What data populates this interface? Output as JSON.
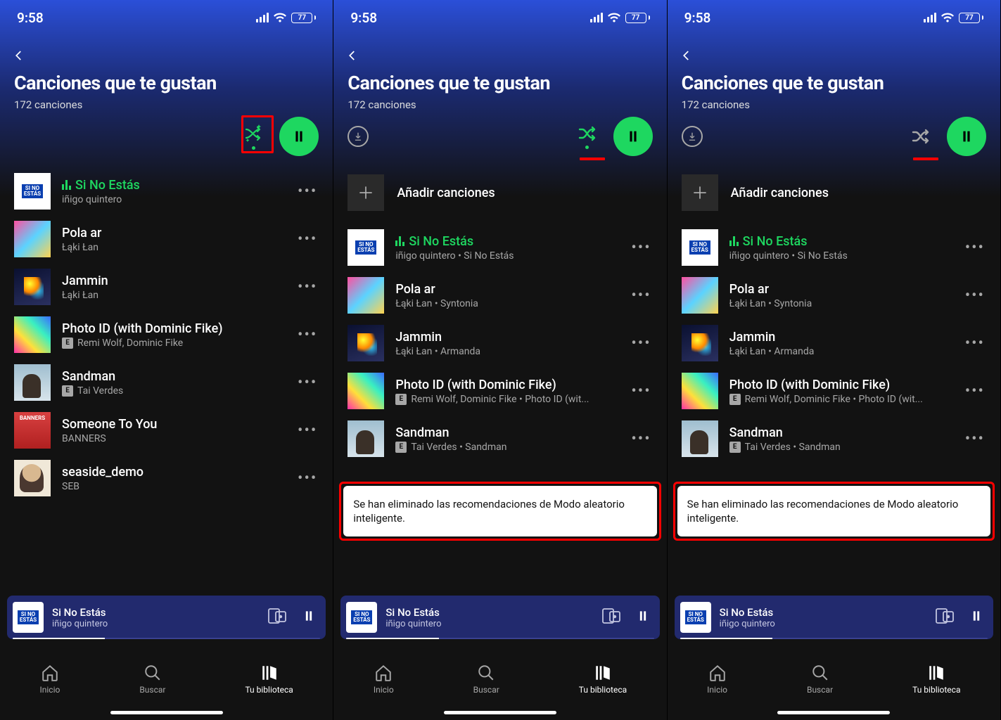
{
  "status": {
    "time": "9:58",
    "battery": "77"
  },
  "header": {
    "title": "Canciones que te gustan",
    "subtitle": "172 canciones"
  },
  "add_songs_label": "Añadir canciones",
  "toast_message": "Se han eliminado las recomendaciones de Modo aleatorio inteligente.",
  "now_playing": {
    "title": "Si No Estás",
    "artist": "iñigo quintero",
    "progress_pct": 30
  },
  "nav": {
    "home": "Inicio",
    "search": "Buscar",
    "library": "Tu biblioteca"
  },
  "tracks_v1": [
    {
      "title": "Si No Estás",
      "sub": "iñigo quintero",
      "art": "art-sino",
      "playing": true,
      "explicit": false
    },
    {
      "title": "Pola ar",
      "sub": "Łąki Łan",
      "art": "art-pola",
      "explicit": false
    },
    {
      "title": "Jammin",
      "sub": "Łąki Łan",
      "art": "art-jammin",
      "explicit": false
    },
    {
      "title": "Photo ID (with Dominic Fike)",
      "sub": "Remi Wolf, Dominic Fike",
      "art": "art-photo",
      "explicit": true
    },
    {
      "title": "Sandman",
      "sub": "Tai Verdes",
      "art": "art-sand",
      "explicit": true
    },
    {
      "title": "Someone To You",
      "sub": "BANNERS",
      "art": "art-someone",
      "explicit": false
    },
    {
      "title": "seaside_demo",
      "sub": "SEB",
      "art": "art-seaside",
      "explicit": false
    }
  ],
  "tracks_v2": [
    {
      "title": "Si No Estás",
      "sub": "iñigo quintero • Si No Estás",
      "art": "art-sino",
      "playing": true,
      "explicit": false
    },
    {
      "title": "Pola ar",
      "sub": "Łąki Łan • Syntonia",
      "art": "art-pola",
      "explicit": false
    },
    {
      "title": "Jammin",
      "sub": "Łąki Łan • Armanda",
      "art": "art-jammin",
      "explicit": false
    },
    {
      "title": "Photo ID (with Dominic Fike)",
      "sub": "Remi Wolf, Dominic Fike • Photo ID (wit...",
      "art": "art-photo",
      "explicit": true
    },
    {
      "title": "Sandman",
      "sub": "Tai Verdes • Sandman",
      "art": "art-sand",
      "explicit": true
    }
  ],
  "screens": [
    {
      "show_download": false,
      "show_highlight_box": true,
      "show_add": false,
      "shuffle_style": "stars",
      "underline": false,
      "toast": false,
      "tracks": "tracks_v1"
    },
    {
      "show_download": true,
      "show_highlight_box": false,
      "show_add": true,
      "shuffle_style": "green",
      "underline": true,
      "toast": true,
      "tracks": "tracks_v2"
    },
    {
      "show_download": true,
      "show_highlight_box": false,
      "show_add": true,
      "shuffle_style": "gray",
      "underline": true,
      "toast": true,
      "tracks": "tracks_v2"
    }
  ]
}
